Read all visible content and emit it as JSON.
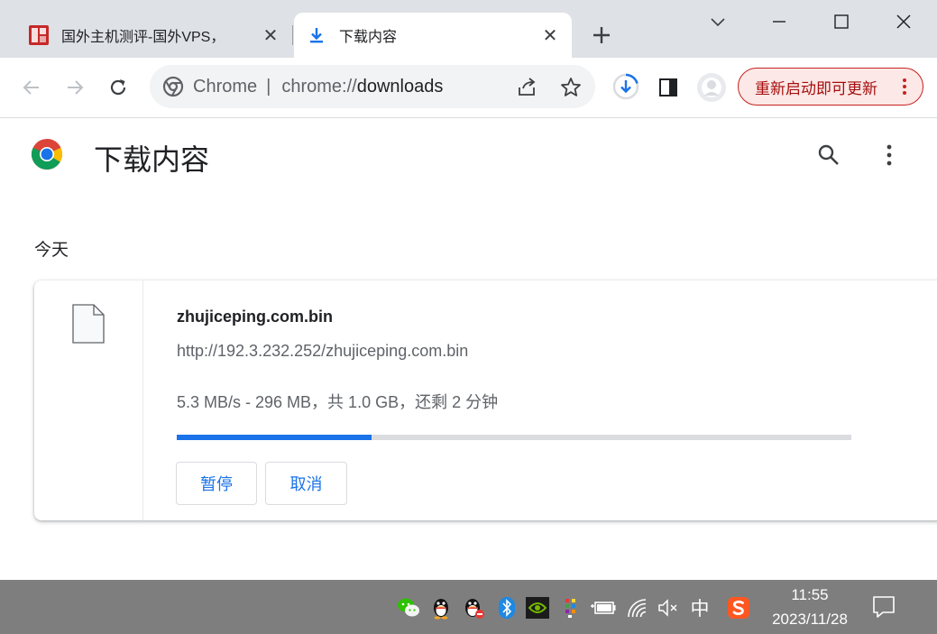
{
  "browser": {
    "tabs": [
      {
        "label": "国外主机测评-国外VPS，",
        "icon": "site-favicon-icon",
        "active": false
      },
      {
        "label": "下载内容",
        "icon": "download-arrow-icon",
        "active": true
      }
    ],
    "omnibox": {
      "chip": "Chrome",
      "divider": "|",
      "scheme": "chrome://",
      "host": "downloads"
    },
    "update_button_label": "重新启动即可更新"
  },
  "page": {
    "title": "下载内容",
    "section_label": "今天"
  },
  "download": {
    "file_name": "zhujiceping.com.bin",
    "url": "http://192.3.232.252/zhujiceping.com.bin",
    "status": "5.3 MB/s - 296 MB，共 1.0 GB，还剩 2 分钟",
    "progress_percent": 28.9,
    "pause_label": "暂停",
    "cancel_label": "取消"
  },
  "taskbar": {
    "ime_label": "中",
    "clock_time": "11:55",
    "clock_date": "2023/11/28"
  },
  "colors": {
    "accent": "#1a73e8",
    "update_red": "#c5221f",
    "taskbar": "#7e7e7e"
  }
}
